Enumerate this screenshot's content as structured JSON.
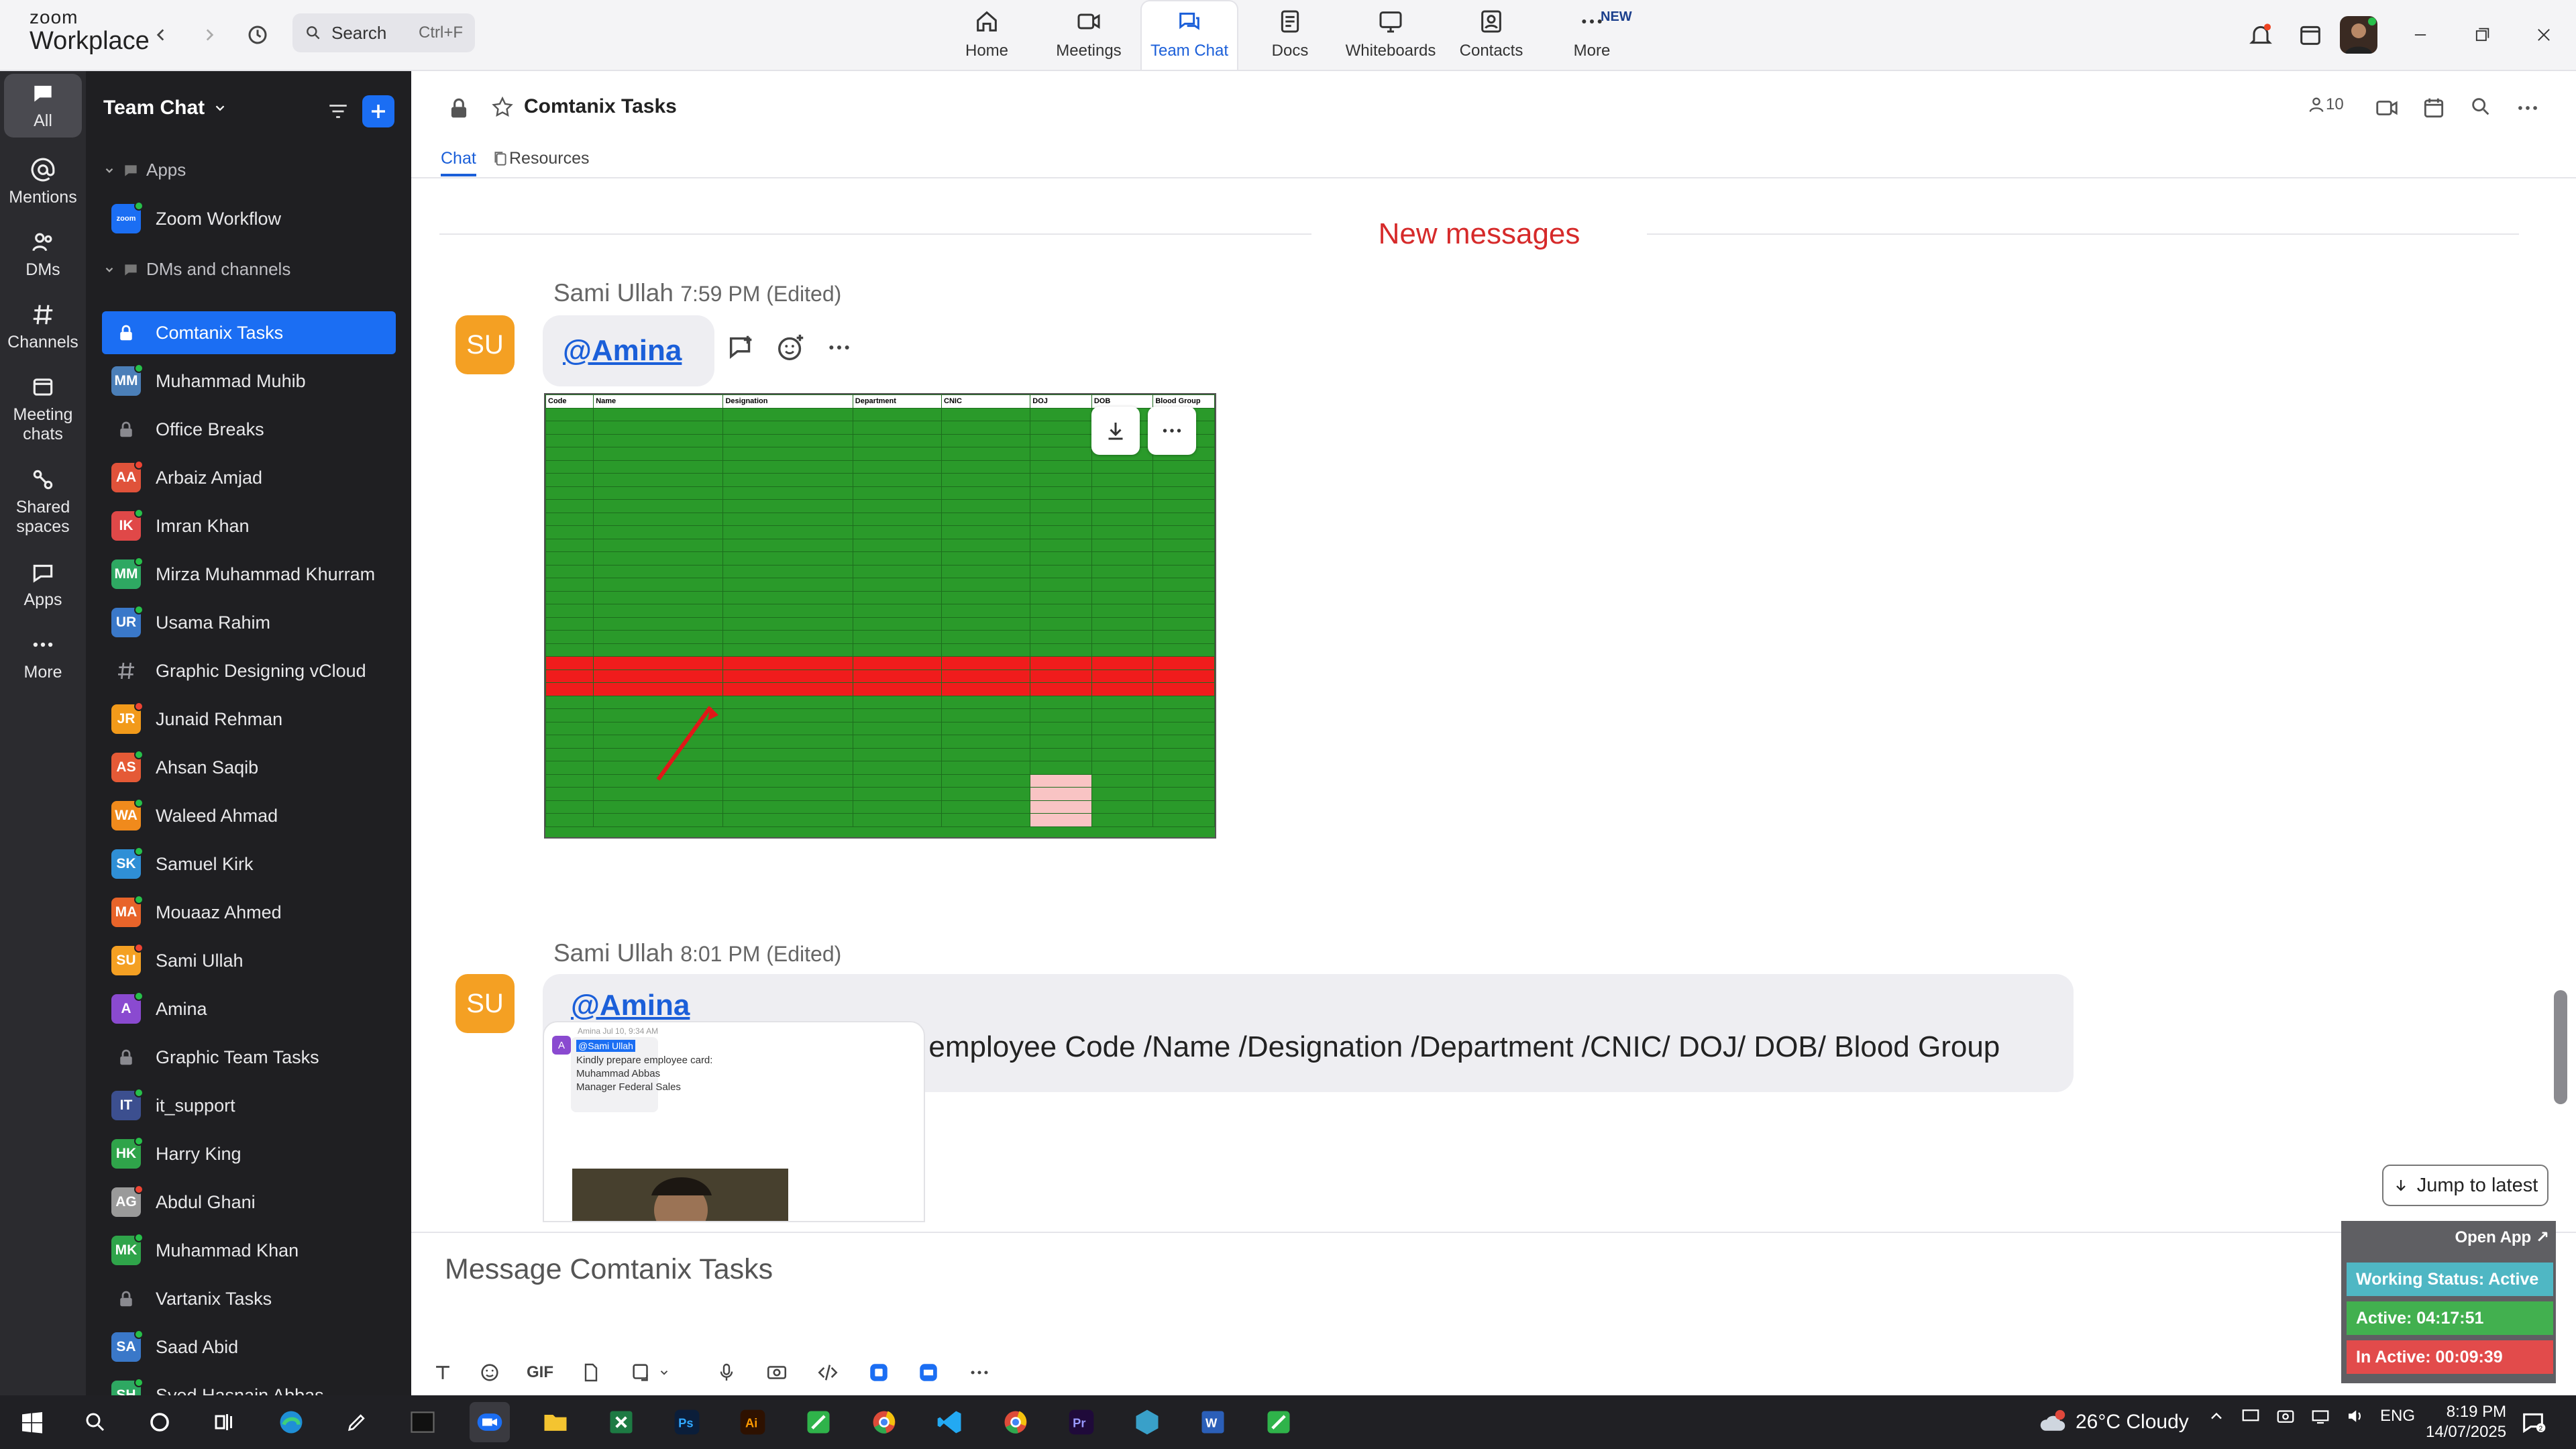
{
  "titlebar": {
    "brand_top": "zoom",
    "brand_bottom": "Workplace",
    "search_placeholder": "Search",
    "search_shortcut": "Ctrl+F",
    "nav": [
      {
        "label": "Home",
        "icon": "home-icon"
      },
      {
        "label": "Meetings",
        "icon": "video-icon"
      },
      {
        "label": "Team Chat",
        "icon": "chat-icon",
        "active": true
      },
      {
        "label": "Docs",
        "icon": "doc-icon"
      },
      {
        "label": "Whiteboards",
        "icon": "whiteboard-icon"
      },
      {
        "label": "Contacts",
        "icon": "contacts-icon"
      },
      {
        "label": "More",
        "icon": "more-icon",
        "badge": "NEW"
      }
    ]
  },
  "rail": [
    "All",
    "Mentions",
    "DMs",
    "Channels",
    "Meeting chats",
    "Shared spaces",
    "Apps",
    "More"
  ],
  "sidebar": {
    "title": "Team Chat",
    "section_apps": "Apps",
    "apps": [
      {
        "name": "Zoom Workflow",
        "initials": "zoom",
        "color": "#1b6ef3"
      }
    ],
    "section_dms": "DMs and channels",
    "items": [
      {
        "name": "Comtanix Tasks",
        "type": "lock",
        "active": true
      },
      {
        "name": "Muhammad Muhib",
        "initials": "MM",
        "color": "#4b7fb8",
        "type": "dm"
      },
      {
        "name": "Office Breaks",
        "type": "lock"
      },
      {
        "name": "Arbaiz Amjad",
        "initials": "AA",
        "color": "#e0523a",
        "type": "dm"
      },
      {
        "name": "Imran Khan",
        "initials": "IK",
        "color": "#e04848",
        "type": "dm"
      },
      {
        "name": "Mirza Muhammad Khurram",
        "initials": "MM",
        "color": "#2ea862",
        "type": "dm"
      },
      {
        "name": "Usama Rahim",
        "initials": "UR",
        "color": "#3a78c9",
        "type": "dm"
      },
      {
        "name": "Graphic Designing vCloud",
        "type": "hash"
      },
      {
        "name": "Junaid Rehman",
        "initials": "JR",
        "color": "#f29a1a",
        "type": "dm"
      },
      {
        "name": "Ahsan Saqib",
        "initials": "AS",
        "color": "#e55a36",
        "type": "dm"
      },
      {
        "name": "Waleed Ahmad",
        "initials": "WA",
        "color": "#f08a1c",
        "type": "dm"
      },
      {
        "name": "Samuel Kirk",
        "initials": "SK",
        "color": "#2f8fd6",
        "type": "dm"
      },
      {
        "name": "Mouaaz Ahmed",
        "initials": "MA",
        "color": "#e8642a",
        "type": "dm"
      },
      {
        "name": "Sami Ullah",
        "initials": "SU",
        "color": "#f4a023",
        "type": "dm"
      },
      {
        "name": "Amina",
        "initials": "A",
        "color": "#8a4ad0",
        "type": "dm"
      },
      {
        "name": "Graphic Team Tasks",
        "type": "lock"
      },
      {
        "name": "it_support",
        "initials": "IT",
        "color": "#3c4f8f",
        "type": "dm"
      },
      {
        "name": "Harry King",
        "initials": "HK",
        "color": "#2fa44a",
        "type": "dm"
      },
      {
        "name": "Abdul Ghani",
        "initials": "AG",
        "color": "#9a9a9a",
        "type": "dm"
      },
      {
        "name": "Muhammad Khan",
        "initials": "MK",
        "color": "#2fa44a",
        "type": "dm"
      },
      {
        "name": "Vartanix Tasks",
        "type": "lock"
      },
      {
        "name": "Saad Abid",
        "initials": "SA",
        "color": "#3a78c9",
        "type": "dm"
      },
      {
        "name": "Syed Hasnain Abbas",
        "initials": "SH",
        "color": "#2ea862",
        "type": "dm"
      }
    ]
  },
  "channel": {
    "title": "Comtanix Tasks",
    "member_count": "10",
    "tabs": [
      "Chat",
      "Resources"
    ],
    "new_messages": "New messages"
  },
  "messages": [
    {
      "sender": "Sami Ullah",
      "time": "7:59 PM (Edited)",
      "initials": "SU",
      "mention": "@Amina"
    },
    {
      "sender": "Sami Ullah",
      "time": "8:01 PM (Edited)",
      "initials": "SU",
      "mention": "@Amina",
      "text": "kindly share details like this  employee Code /Name /Designation /Department /CNIC/ DOJ/ DOB/ Blood Group"
    }
  ],
  "sheet": {
    "headers": [
      "Code",
      "Name",
      "Designation",
      "Department",
      "CNIC",
      "DOJ",
      "DOB",
      "Blood Group"
    ]
  },
  "card": {
    "initial": "A",
    "meta": "Amina  Jul 10, 9:34 AM",
    "mention": "@Sami Ullah",
    "lines": [
      "Kindly prepare employee card:",
      "Muhammad Abbas",
      "Manager Federal Sales"
    ]
  },
  "jump_label": "Jump to latest",
  "composer_placeholder": "Message Comtanix Tasks",
  "composer_tools": [
    "text-format-icon",
    "emoji-icon",
    "GIF",
    "file-icon",
    "screenshot-icon",
    "microphone-icon",
    "video-message-icon",
    "code-icon",
    "app-icon",
    "app2-icon",
    "more-icon"
  ],
  "widget": {
    "open_app": "Open App ↗",
    "working_status": "Working Status: Active",
    "active": "Active: 04:17:51",
    "inactive": "In Active: 00:09:39"
  },
  "taskbar": {
    "weather": "26°C  Cloudy",
    "lang": "ENG",
    "time": "8:19 PM",
    "date": "14/07/2025"
  }
}
